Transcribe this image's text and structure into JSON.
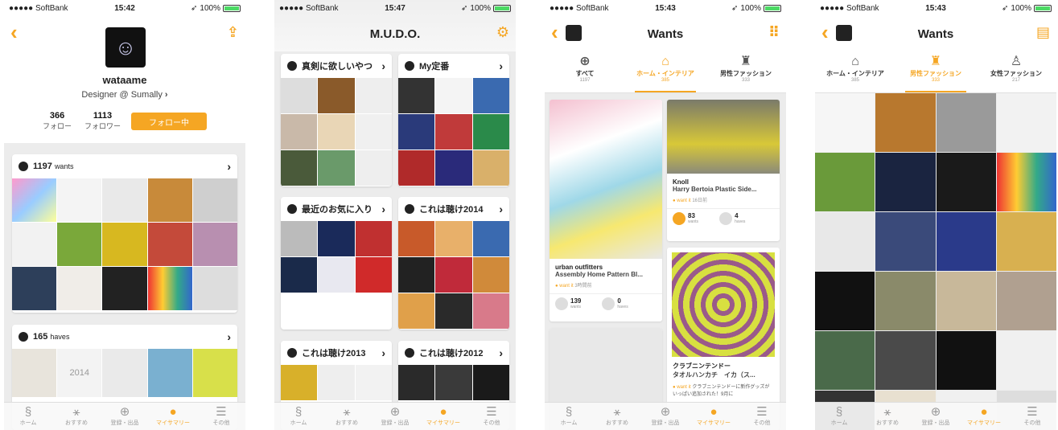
{
  "status": {
    "carrier": "●●●●● SoftBank",
    "battery": "100%",
    "times": [
      "15:42",
      "15:47",
      "15:43",
      "15:43"
    ]
  },
  "colors": {
    "accent": "#f5a623"
  },
  "tabbar": [
    "ホーム",
    "おすすめ",
    "登録・出品",
    "マイサマリー",
    "その他"
  ],
  "profile": {
    "name": "wataame",
    "subtitle": "Designer @ Sumally",
    "follow_count": "366",
    "follow_label": "フォロー",
    "follower_count": "1113",
    "follower_label": "フォロワー",
    "follow_button": "フォロー中",
    "wants_count": "1197",
    "wants_label": "wants",
    "haves_count": "165",
    "haves_label": "haves",
    "have_caption": "2014"
  },
  "collections": {
    "title": "M.U.D.O.",
    "items": [
      "真剣に欲しいやつ",
      "My定番",
      "最近のお気に入り",
      "これは聴け2014",
      "これは聴け2013",
      "これは聴け2012"
    ]
  },
  "wants": {
    "title": "Wants",
    "categories": [
      {
        "label": "すべて",
        "count": "1197"
      },
      {
        "label": "ホーム・インテリア",
        "count": "385"
      },
      {
        "label": "男性ファッション",
        "count": "333"
      },
      {
        "label": "女性ファッション",
        "count": "217"
      }
    ],
    "pin_left": {
      "brand": "urban outfitters",
      "title": "Assembly Home Pattern Bl...",
      "want": "want it",
      "time": "3時間前",
      "wants": "139",
      "wants_label": "wants",
      "haves": "0",
      "haves_label": "haves"
    },
    "pin_right": {
      "brand": "Knoll",
      "title": "Harry Bertoia Plastic Side...",
      "want": "want it",
      "time": "16日前",
      "wants": "83",
      "wants_label": "wants",
      "haves": "4",
      "haves_label": "haves"
    },
    "pin_right2": {
      "brand": "クラブニンテンドー",
      "title": "タオルハンカチ　イカ（ス...",
      "want": "want it",
      "desc": "クラブニンテンドーに新作グッズがいっぱい追加された！9月に"
    }
  }
}
